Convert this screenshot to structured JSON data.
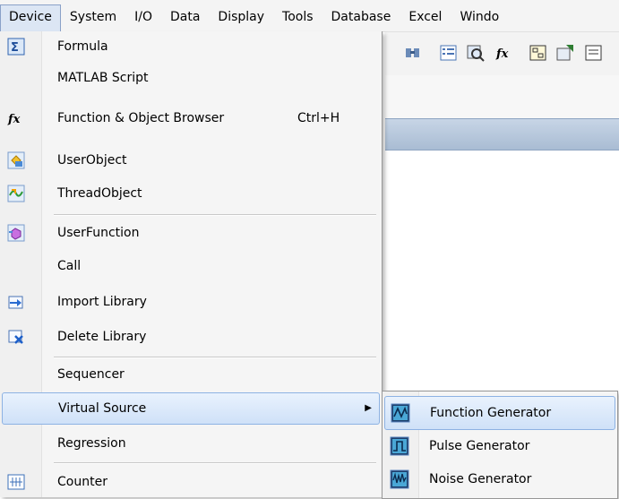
{
  "menubar": {
    "items": [
      "Device",
      "System",
      "I/O",
      "Data",
      "Display",
      "Tools",
      "Database",
      "Excel",
      "Windo"
    ]
  },
  "device_menu": {
    "items": [
      {
        "label": "Formula",
        "icon": "sigma-icon"
      },
      {
        "label": "MATLAB Script",
        "icon": ""
      },
      {
        "label": "Function & Object Browser",
        "shortcut": "Ctrl+H",
        "icon": "fx-icon"
      },
      {
        "label": "UserObject",
        "icon": "userobject-icon"
      },
      {
        "label": "ThreadObject",
        "icon": "threadobject-icon"
      },
      {
        "label": "UserFunction",
        "icon": "userfunction-icon"
      },
      {
        "label": "Call",
        "icon": ""
      },
      {
        "label": "Import Library",
        "icon": "import-library-icon"
      },
      {
        "label": "Delete Library",
        "icon": "delete-library-icon"
      },
      {
        "label": "Sequencer",
        "icon": ""
      },
      {
        "label": "Virtual Source",
        "icon": "",
        "has_submenu": true
      },
      {
        "label": "Regression",
        "icon": ""
      },
      {
        "label": "Counter",
        "icon": "counter-icon"
      }
    ]
  },
  "virtual_source_submenu": {
    "items": [
      {
        "label": "Function Generator",
        "icon": "function-generator-icon"
      },
      {
        "label": "Pulse Generator",
        "icon": "pulse-generator-icon"
      },
      {
        "label": "Noise Generator",
        "icon": "noise-generator-icon"
      }
    ]
  },
  "colors": {
    "highlight_border": "#8db2e3",
    "highlight_fill": "#cfe1f8",
    "titlebar": "#a9bcd3"
  }
}
